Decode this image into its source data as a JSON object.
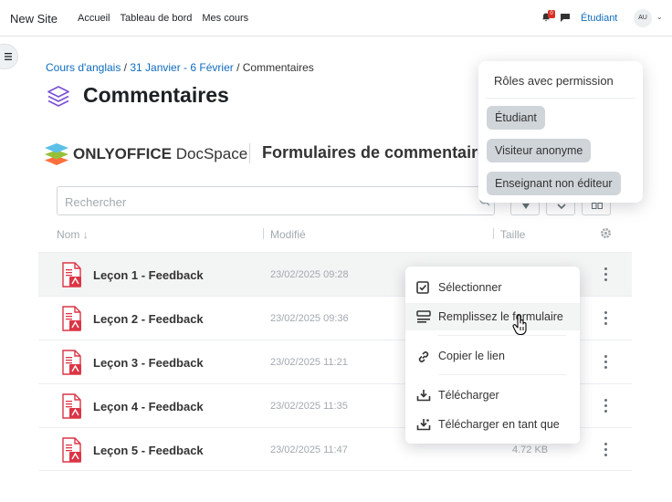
{
  "topnav": {
    "site_name": "New Site",
    "links": [
      "Accueil",
      "Tableau de bord",
      "Mes cours"
    ],
    "notification_count": "0",
    "user_role": "Étudiant",
    "avatar_initials": "AU"
  },
  "breadcrumb": {
    "course": "Cours d'anglais",
    "section": "31 Janvier - 6 Février",
    "current": "Commentaires",
    "separator": " / "
  },
  "page": {
    "title": "Commentaires"
  },
  "docspace": {
    "brand_bold": "ONLYOFFICE",
    "brand_light": " DocSpace",
    "room_title": "Formulaires de commentaires",
    "search_placeholder": "Rechercher",
    "columns": {
      "name": "Nom",
      "modified": "Modifié",
      "size": "Taille"
    },
    "files": [
      {
        "name": "Leçon 1 - Feedback",
        "modified": "23/02/2025 09:28",
        "size": ""
      },
      {
        "name": "Leçon 2 - Feedback",
        "modified": "23/02/2025 09:36",
        "size": ""
      },
      {
        "name": "Leçon 3 - Feedback",
        "modified": "23/02/2025 11:21",
        "size": ""
      },
      {
        "name": "Leçon 4 - Feedback",
        "modified": "23/02/2025 11:35",
        "size": ""
      },
      {
        "name": "Leçon 5 - Feedback",
        "modified": "23/02/2025 11:47",
        "size": "4.72 KB"
      }
    ]
  },
  "context_menu": {
    "items": [
      {
        "label": "Sélectionner",
        "icon": "checkbox-icon"
      },
      {
        "label": "Remplissez le formulaire",
        "icon": "fill-form-icon"
      },
      {
        "label": "Copier le lien",
        "icon": "link-icon"
      },
      {
        "label": "Télécharger",
        "icon": "download-icon"
      },
      {
        "label": "Télécharger en tant que",
        "icon": "download-as-icon"
      }
    ]
  },
  "roles_popup": {
    "title": "Rôles avec permission",
    "roles": [
      "Étudiant",
      "Visiteur anonyme",
      "Enseignant non éditeur"
    ]
  },
  "colors": {
    "link": "#0f6cbf",
    "accent": "#7b53d6",
    "pdf_red": "#dc3545"
  }
}
